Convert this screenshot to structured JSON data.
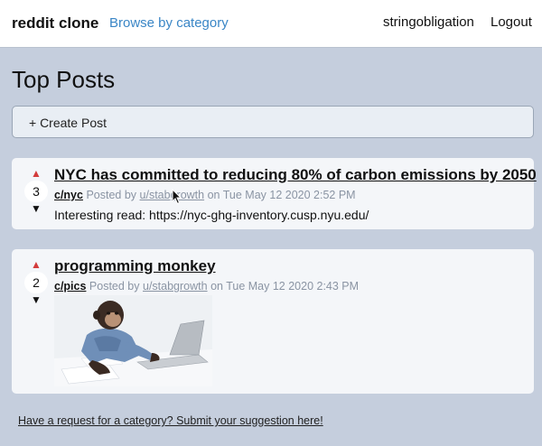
{
  "navbar": {
    "brand": "reddit clone",
    "browse_label": "Browse by category",
    "username": "stringobligation",
    "logout_label": "Logout"
  },
  "page": {
    "title": "Top Posts",
    "create_post_label": "+ Create Post"
  },
  "posts": [
    {
      "score": "3",
      "title": "NYC has committed to reducing 80% of carbon emissions by 2050",
      "subreddit": "c/nyc",
      "posted_by_prefix": "Posted by",
      "author": "u/stabgrowth",
      "date_text": "on Tue May 12 2020 2:52 PM",
      "body": "Interesting read: https://nyc-ghg-inventory.cusp.nyu.edu/"
    },
    {
      "score": "2",
      "title": "programming monkey",
      "subreddit": "c/pics",
      "posted_by_prefix": "Posted by",
      "author": "u/stabgrowth",
      "date_text": "on Tue May 12 2020 2:43 PM",
      "image": "chimpanzee-at-laptop-photo"
    }
  ],
  "footer": {
    "suggestion_link": "Have a request for a category? Submit your suggestion here!"
  },
  "icons": {
    "upvote": "up-arrow-icon",
    "downvote": "down-arrow-icon"
  },
  "colors": {
    "page_bg": "#c5cedd",
    "link_blue": "#3a86c6",
    "upvote_red": "#d33b3b"
  }
}
